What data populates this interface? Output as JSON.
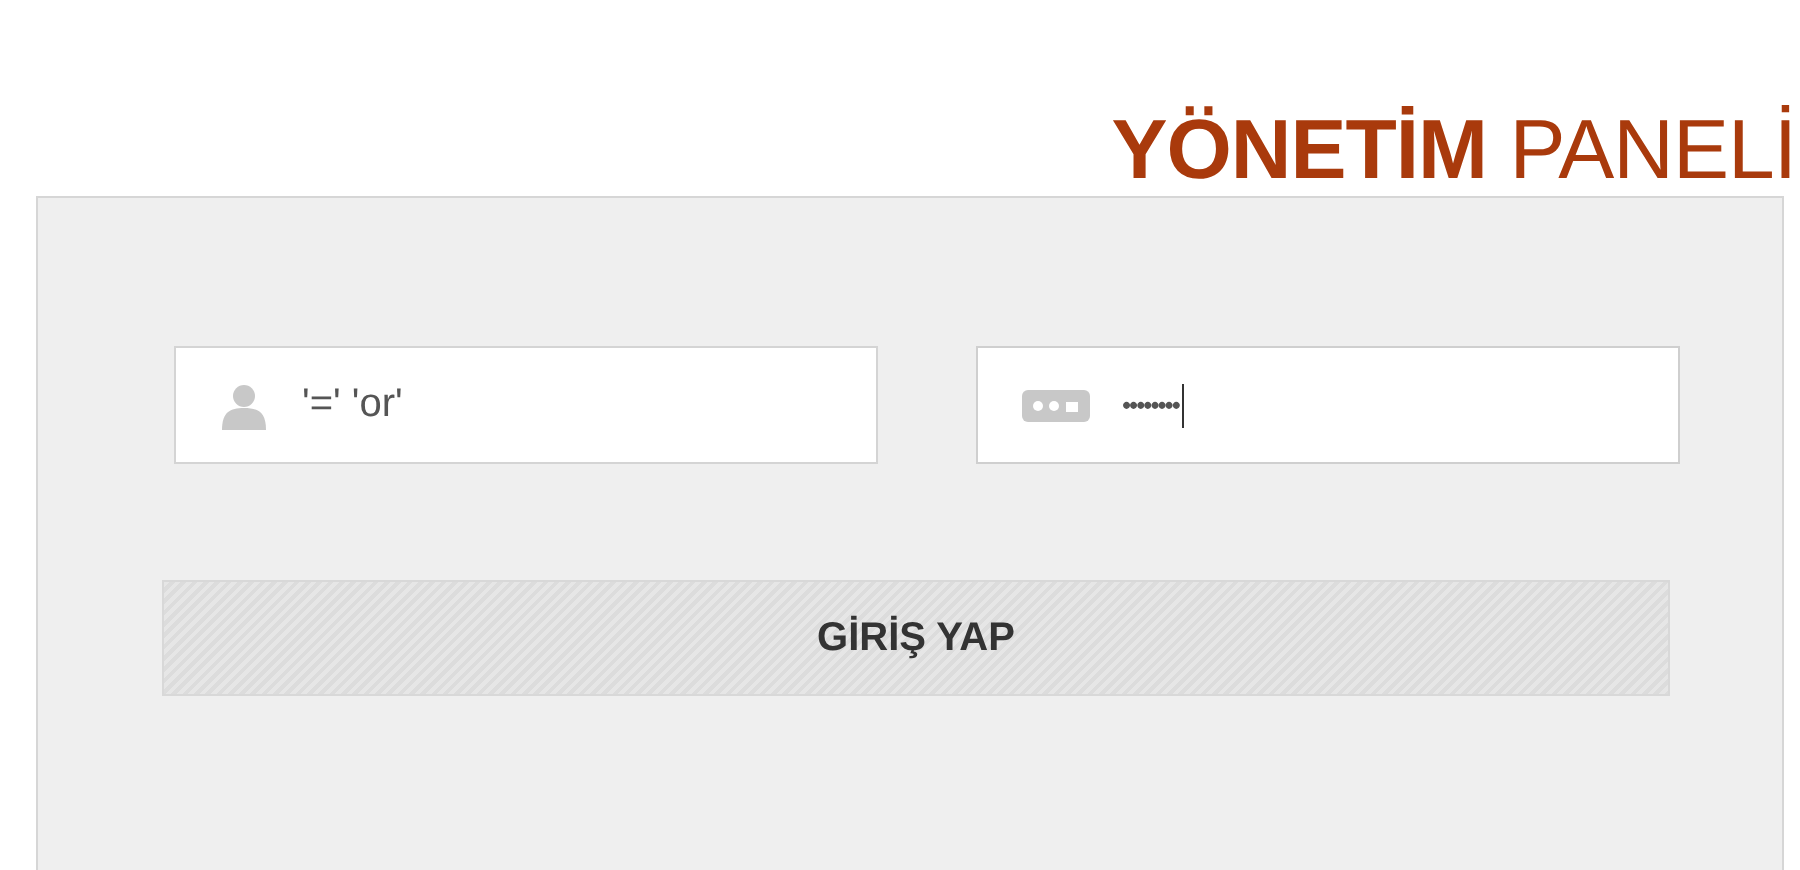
{
  "title": "**YÖNETİM** PANELİ",
  "username": {
    "value": "'=' 'or'"
  },
  "password": {
    "value": "••••••••",
    "focused": true
  },
  "submit": {
    "label": "GİRİŞ YAP"
  }
}
